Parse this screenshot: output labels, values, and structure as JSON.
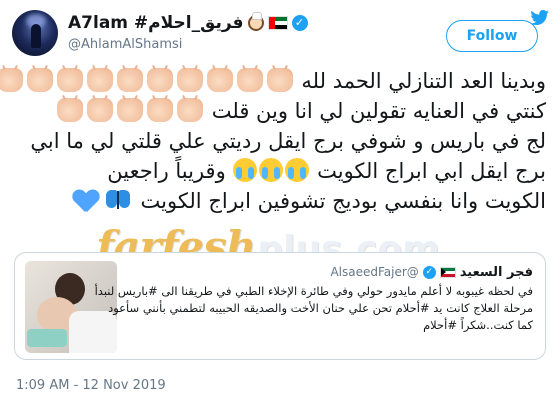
{
  "account": {
    "display_name": "A7lam #فريق_احلام",
    "handle": "@AhlamAlShamsi",
    "follow_label": "Follow"
  },
  "tweet": {
    "lines": [
      "وبدينا العد التنازلي الحمد لله",
      "كنتي في العنايه تقولين لي انا وين قلت",
      "لج في باريس و شوفي برج ايقل رديتي علي قلتي لي ما ابي",
      "برج ايقل ابي ابراج الكويت",
      "وقريباً راجعين",
      "الكويت وانا بنفسي بوديج تشوفين ابراج الكويت"
    ]
  },
  "icons": {
    "clap": "clapping-hands-emoji",
    "cry": "loudly-crying-face-emoji",
    "heart": "blue-heart-emoji",
    "butterfly": "butterfly-emoji",
    "verified": "verified-badge",
    "brand": "twitter-bird-icon"
  },
  "watermark": {
    "main": "farfesh",
    "sub": "plus.com"
  },
  "quoted_tweet": {
    "name": "فجر السعيد",
    "handle": "@AlsaeedFajer",
    "lines": [
      "في لحظه غيبوبه لا أعلم مايدور حولي وفي طائرة الإخلاء الطبي في طريقنا الى #باريس لنبدأ",
      "مرحلة العلاج كانت يد #أحلام تحن علي حنان الأخت والصديقه الحبيبه لتطمني بأنني سأعود",
      "كما كنت..شكراً #أحلام"
    ]
  },
  "timestamp": "1:09 AM - 12 Nov 2019",
  "colors": {
    "accent": "#1da1f2",
    "watermark_gold": "#eab13c"
  }
}
